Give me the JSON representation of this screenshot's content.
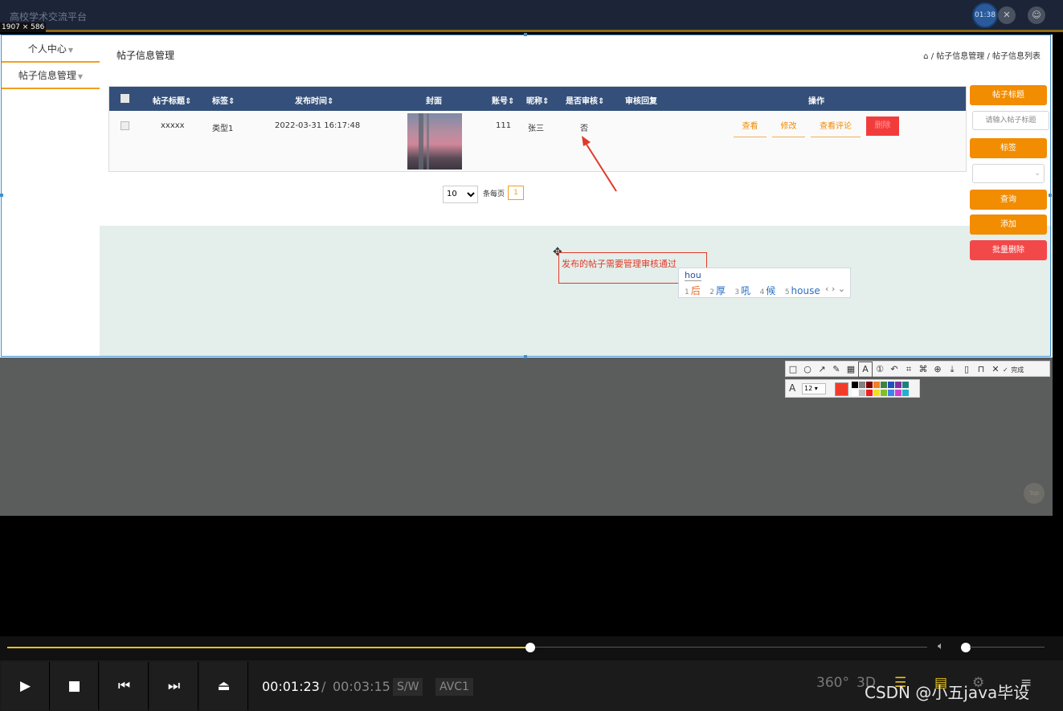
{
  "window": {
    "app_title": "高校学术交流平台",
    "capture_dims": "1907 × 586",
    "timer": "01:38"
  },
  "sidebar": {
    "items": [
      {
        "label": "个人中心"
      },
      {
        "label": "帖子信息管理"
      }
    ]
  },
  "main": {
    "heading": "帖子信息管理",
    "breadcrumb": {
      "home_icon": "⌂",
      "path": "/ 帖子信息管理 / 帖子信息列表"
    }
  },
  "table": {
    "columns": [
      "帖子标题",
      "标签",
      "发布时间",
      "封面",
      "账号",
      "昵称",
      "是否审核",
      "审核回复",
      "操作"
    ],
    "sort_mark": "⇕",
    "rows": [
      {
        "title": "xxxxx",
        "tag": "类型1",
        "published": "2022-03-31 16:17:48",
        "account": "111",
        "nickname": "张三",
        "reviewed": "否",
        "review_reply": "",
        "actions": {
          "view": "查看",
          "edit": "修改",
          "comments": "查看评论",
          "delete": "删除"
        }
      }
    ]
  },
  "pagination": {
    "page_size": "10",
    "per_page_label": "条每页",
    "current_page": "1"
  },
  "search_panel": {
    "title_label": "帖子标题",
    "title_placeholder": "请输入帖子标题",
    "tag_label": "标签",
    "query_button": "查询",
    "add_button": "添加",
    "batch_delete_button": "批量删除"
  },
  "annotation": {
    "text": "发布的帖子需要管理审核通过",
    "color": "#e03a2a"
  },
  "ime": {
    "typed": "hou",
    "candidates": [
      {
        "num": "1",
        "text": "后"
      },
      {
        "num": "2",
        "text": "厚"
      },
      {
        "num": "3",
        "text": "吼"
      },
      {
        "num": "4",
        "text": "候"
      },
      {
        "num": "5",
        "text": "house"
      }
    ]
  },
  "screenshot_tool": {
    "done_label": "完成",
    "font_size": "12",
    "current_color": "#f23c2a",
    "palette": [
      "#000000",
      "#808080",
      "#800000",
      "#f08020",
      "#408040",
      "#2050c0",
      "#8030a0",
      "#208080",
      "#ffffff",
      "#c0c0c0",
      "#f02020",
      "#f0e020",
      "#80c020",
      "#4080f0",
      "#d040d0",
      "#20b0d0"
    ]
  },
  "back_to_top": "Top",
  "player": {
    "progress": 0.503,
    "volume": 0.0,
    "current_time": "00:01:23",
    "separator": "/",
    "total_time": "00:03:15",
    "tag_sw": "S/W",
    "tag_codec": "AVC1",
    "icon_360": "360°",
    "icon_3d": "3D",
    "watermark": "CSDN @小五java毕设",
    "accent": "#e8c21a"
  }
}
